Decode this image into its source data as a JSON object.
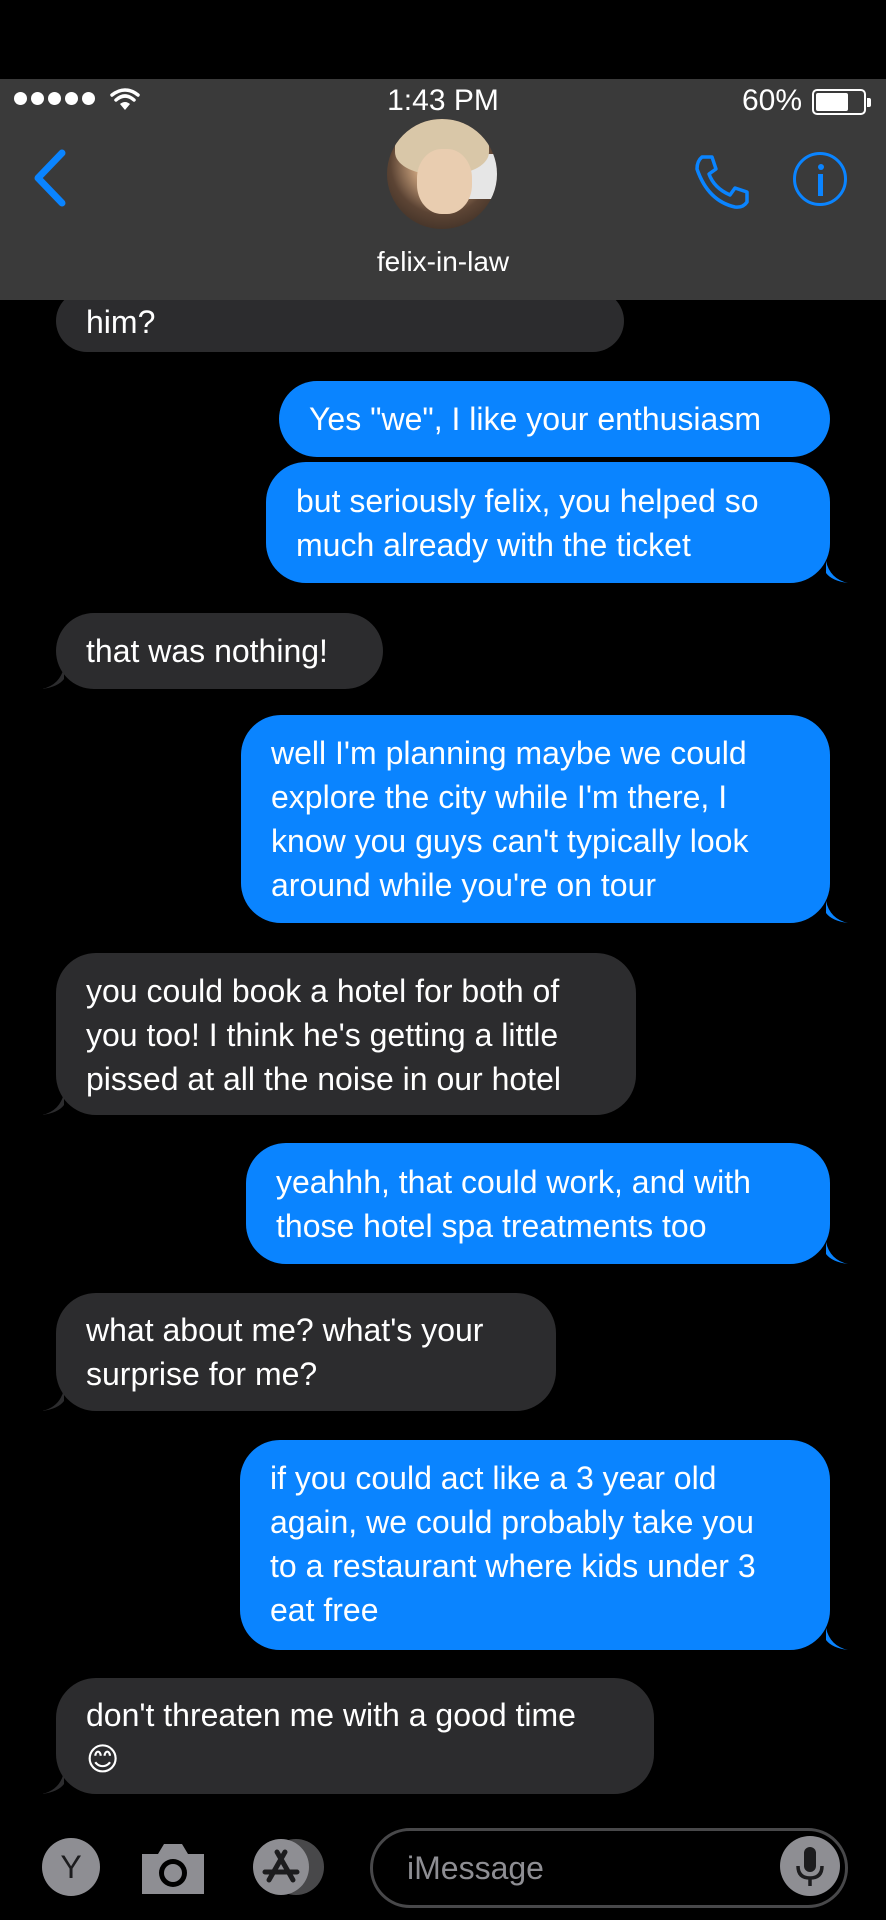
{
  "status_bar": {
    "time": "1:43 PM",
    "battery_percent": "60%",
    "battery_level": 0.6
  },
  "header": {
    "contact_name": "felix-in-law"
  },
  "messages": [
    {
      "from": "contact",
      "text": "him?"
    },
    {
      "from": "me",
      "text": "Yes \"we\", I like your enthusiasm"
    },
    {
      "from": "me",
      "text": "but seriously felix, you helped so\nmuch already with the ticket"
    },
    {
      "from": "contact",
      "text": "that was nothing!"
    },
    {
      "from": "me",
      "text": "well I'm planning maybe we could\nexplore the city while I'm there, I\nknow you guys can't typically look\naround while you're on tour"
    },
    {
      "from": "contact",
      "text": "you could book a hotel for both of\nyou too! I think he's getting a little\npissed at all the noise in our hotel"
    },
    {
      "from": "me",
      "text": "yeahhh, that could work, and with\nthose hotel spa treatments too"
    },
    {
      "from": "contact",
      "text": "what about me? what's your\nsurprise for me?"
    },
    {
      "from": "me",
      "text": "if you could act like a 3 year old\nagain, we could probably take you\nto a restaurant where kids under 3\neat free"
    },
    {
      "from": "contact",
      "text": "don't threaten me with a good time\n😊"
    }
  ],
  "input_bar": {
    "app_letter": "Y",
    "placeholder": "iMessage"
  },
  "colors": {
    "sent": "#0a84ff",
    "received": "#2c2c2e",
    "accent": "#0a84ff"
  }
}
